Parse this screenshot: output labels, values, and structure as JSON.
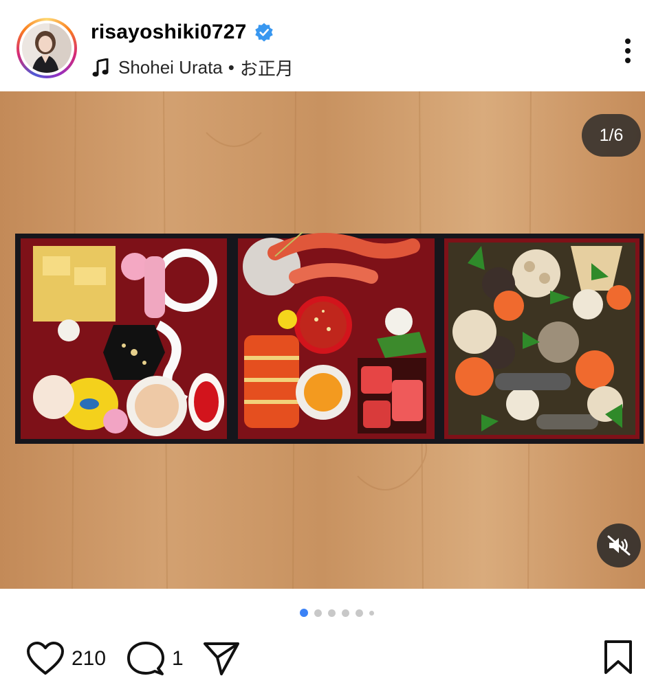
{
  "post": {
    "username": "risayoshiki0727",
    "verified": true,
    "audio": {
      "artist": "Shohei Urata",
      "separator": "•",
      "track": "お正月"
    },
    "menu_icon": "more-vertical-icon"
  },
  "media": {
    "counter": "1/6",
    "slide_count": 6,
    "active_slide": 1,
    "mute_icon": "speaker-muted-icon"
  },
  "actions": {
    "likes": "210",
    "comments": "1",
    "like_icon": "heart-icon",
    "comment_icon": "comment-icon",
    "share_icon": "send-icon",
    "save_icon": "bookmark-icon"
  },
  "colors": {
    "verified_blue": "#3897f0",
    "active_dot": "#3b82f6",
    "box_red": "#8a1419",
    "box_black": "#1c1c22",
    "wood": "#c79466"
  }
}
